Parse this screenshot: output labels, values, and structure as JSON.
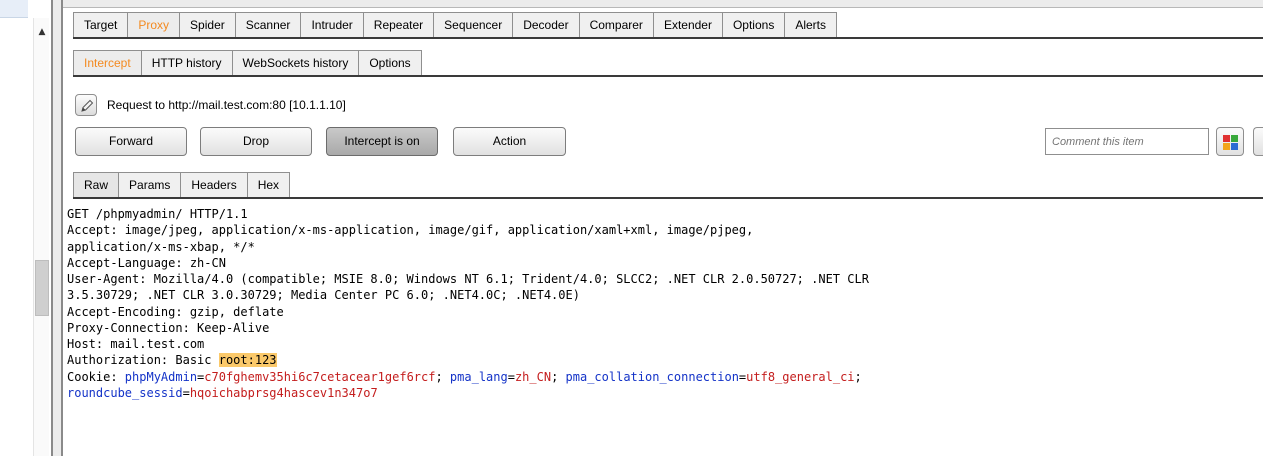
{
  "tool_tabs": [
    "Target",
    "Proxy",
    "Spider",
    "Scanner",
    "Intruder",
    "Repeater",
    "Sequencer",
    "Decoder",
    "Comparer",
    "Extender",
    "Options",
    "Alerts"
  ],
  "active_tool_tab": "Proxy",
  "proxy_tabs": [
    "Intercept",
    "HTTP history",
    "WebSockets history",
    "Options"
  ],
  "active_proxy_tab": "Intercept",
  "request_info": "Request to http://mail.test.com:80  [10.1.1.10]",
  "buttons": {
    "forward": "Forward",
    "drop": "Drop",
    "intercept": "Intercept is on",
    "action": "Action"
  },
  "comment_placeholder": "Comment this item",
  "message_tabs": [
    "Raw",
    "Params",
    "Headers",
    "Hex"
  ],
  "active_message_tab": "Raw",
  "request": {
    "line1": "GET /phpmyadmin/ HTTP/1.1",
    "line2": "Accept: image/jpeg, application/x-ms-application, image/gif, application/xaml+xml, image/pjpeg,",
    "line3": "application/x-ms-xbap, */*",
    "line4": "Accept-Language: zh-CN",
    "line5": "User-Agent: Mozilla/4.0 (compatible; MSIE 8.0; Windows NT 6.1; Trident/4.0; SLCC2; .NET CLR 2.0.50727; .NET CLR",
    "line6": "3.5.30729; .NET CLR 3.0.30729; Media Center PC 6.0; .NET4.0C; .NET4.0E)",
    "line7": "Accept-Encoding: gzip, deflate",
    "line8": "Proxy-Connection: Keep-Alive",
    "line9": "Host: mail.test.com",
    "auth_prefix": "Authorization: Basic ",
    "auth_value": "root:123",
    "cookie_prefix": "Cookie: ",
    "cookies": [
      {
        "name": "phpMyAdmin",
        "value": "c70fghemv35hi6c7cetacear1gef6rcf"
      },
      {
        "name": "pma_lang",
        "value": "zh_CN"
      },
      {
        "name": "pma_collation_connection",
        "value": "utf8_general_ci"
      },
      {
        "name": "roundcube_sessid",
        "value": "hqoichabprsg4hascev1n347o7"
      }
    ]
  },
  "colors": {
    "active_tab": "#f38a20",
    "cookie_name": "#1433c8",
    "cookie_value": "#c41d1d",
    "highlight": "#fbc96a"
  }
}
